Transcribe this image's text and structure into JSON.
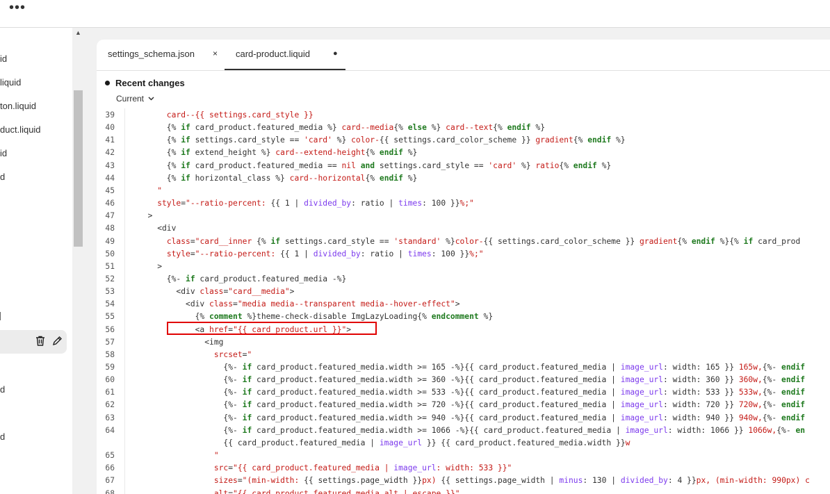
{
  "topbar": {
    "menu_icon": "more-horizontal-icon"
  },
  "sidebar": {
    "items": [
      {
        "label": "id"
      },
      {
        "label": "liquid"
      },
      {
        "label": "ton.liquid"
      },
      {
        "label": "duct.liquid"
      },
      {
        "label": "id"
      },
      {
        "label": "d"
      },
      {
        "label": ""
      },
      {
        "label": "d"
      },
      {
        "label": "d"
      }
    ],
    "active_tools": [
      "trash-icon",
      "pencil-icon"
    ]
  },
  "tabs": [
    {
      "label": "settings_schema.json",
      "close": "×"
    },
    {
      "label": "card-product.liquid",
      "modified": "●"
    }
  ],
  "recent_changes": {
    "title": "Recent changes",
    "version": "Current"
  },
  "code": {
    "line_numbers": [
      "39",
      "40",
      "41",
      "42",
      "43",
      "44",
      "45",
      "46",
      "47",
      "48",
      "49",
      "50",
      "51",
      "52",
      "53",
      "54",
      "55",
      "56",
      "57",
      "58",
      "59",
      "60",
      "61",
      "62",
      "63",
      "64",
      "",
      "65",
      "66",
      "67",
      "68"
    ],
    "lines": [
      [
        [
          "str",
          "      card--{{ settings.card_style }}"
        ]
      ],
      [
        [
          "plain",
          "      {% "
        ],
        [
          "kw",
          "if"
        ],
        [
          "plain",
          " card_product.featured_media %} "
        ],
        [
          "str",
          "card--media"
        ],
        [
          "plain",
          "{% "
        ],
        [
          "kw",
          "else"
        ],
        [
          "plain",
          " %} "
        ],
        [
          "str",
          "card--text"
        ],
        [
          "plain",
          "{% "
        ],
        [
          "kw",
          "endif"
        ],
        [
          "plain",
          " %}"
        ]
      ],
      [
        [
          "plain",
          "      {% "
        ],
        [
          "kw",
          "if"
        ],
        [
          "plain",
          " settings.card_style == "
        ],
        [
          "str",
          "'card'"
        ],
        [
          "plain",
          " %} "
        ],
        [
          "str",
          "color-"
        ],
        [
          "plain",
          "{{ settings.card_color_scheme }} "
        ],
        [
          "str",
          "gradient"
        ],
        [
          "plain",
          "{% "
        ],
        [
          "kw",
          "endif"
        ],
        [
          "plain",
          " %}"
        ]
      ],
      [
        [
          "plain",
          "      {% "
        ],
        [
          "kw",
          "if"
        ],
        [
          "plain",
          " extend_height %} "
        ],
        [
          "str",
          "card--extend-height"
        ],
        [
          "plain",
          "{% "
        ],
        [
          "kw",
          "endif"
        ],
        [
          "plain",
          " %}"
        ]
      ],
      [
        [
          "plain",
          "      {% "
        ],
        [
          "kw",
          "if"
        ],
        [
          "plain",
          " card_product.featured_media == "
        ],
        [
          "str",
          "nil"
        ],
        [
          "plain",
          " "
        ],
        [
          "kw",
          "and"
        ],
        [
          "plain",
          " settings.card_style == "
        ],
        [
          "str",
          "'card'"
        ],
        [
          "plain",
          " %} "
        ],
        [
          "str",
          "ratio"
        ],
        [
          "plain",
          "{% "
        ],
        [
          "kw",
          "endif"
        ],
        [
          "plain",
          " %}"
        ]
      ],
      [
        [
          "plain",
          "      {% "
        ],
        [
          "kw",
          "if"
        ],
        [
          "plain",
          " horizontal_class %} "
        ],
        [
          "str",
          "card--horizontal"
        ],
        [
          "plain",
          "{% "
        ],
        [
          "kw",
          "endif"
        ],
        [
          "plain",
          " %}"
        ]
      ],
      [
        [
          "str",
          "    \""
        ]
      ],
      [
        [
          "str",
          "    style"
        ],
        [
          "plain",
          "="
        ],
        [
          "str",
          "\"--ratio-percent: "
        ],
        [
          "plain",
          "{{ 1 | "
        ],
        [
          "prop",
          "divided_by"
        ],
        [
          "plain",
          ": ratio | "
        ],
        [
          "prop",
          "times"
        ],
        [
          "plain",
          ": 100 }}"
        ],
        [
          "str",
          "%;\""
        ]
      ],
      [
        [
          "plain",
          "  >"
        ]
      ],
      [
        [
          "plain",
          "    <div"
        ]
      ],
      [
        [
          "plain",
          "      "
        ],
        [
          "str",
          "class"
        ],
        [
          "plain",
          "="
        ],
        [
          "str",
          "\"card__inner "
        ],
        [
          "plain",
          "{% "
        ],
        [
          "kw",
          "if"
        ],
        [
          "plain",
          " settings.card_style == "
        ],
        [
          "str",
          "'standard'"
        ],
        [
          "plain",
          " %}"
        ],
        [
          "str",
          "color-"
        ],
        [
          "plain",
          "{{ settings.card_color_scheme }} "
        ],
        [
          "str",
          "gradient"
        ],
        [
          "plain",
          "{% "
        ],
        [
          "kw",
          "endif"
        ],
        [
          "plain",
          " %}{% "
        ],
        [
          "kw",
          "if"
        ],
        [
          "plain",
          " card_prod"
        ]
      ],
      [
        [
          "plain",
          "      "
        ],
        [
          "str",
          "style"
        ],
        [
          "plain",
          "="
        ],
        [
          "str",
          "\"--ratio-percent: "
        ],
        [
          "plain",
          "{{ 1 | "
        ],
        [
          "prop",
          "divided_by"
        ],
        [
          "plain",
          ": ratio | "
        ],
        [
          "prop",
          "times"
        ],
        [
          "plain",
          ": 100 }}"
        ],
        [
          "str",
          "%;\""
        ]
      ],
      [
        [
          "plain",
          "    >"
        ]
      ],
      [
        [
          "plain",
          "      {%- "
        ],
        [
          "kw",
          "if"
        ],
        [
          "plain",
          " card_product.featured_media -%}"
        ]
      ],
      [
        [
          "plain",
          "        <div "
        ],
        [
          "str",
          "class"
        ],
        [
          "plain",
          "="
        ],
        [
          "str",
          "\"card__media\""
        ],
        [
          "plain",
          ">"
        ]
      ],
      [
        [
          "plain",
          "          <div "
        ],
        [
          "str",
          "class"
        ],
        [
          "plain",
          "="
        ],
        [
          "str",
          "\"media media--transparent media--hover-effect\""
        ],
        [
          "plain",
          ">"
        ]
      ],
      [
        [
          "plain",
          "            {% "
        ],
        [
          "kw",
          "comment"
        ],
        [
          "plain",
          " %}theme-check-disable ImgLazyLoading{% "
        ],
        [
          "kw",
          "endcomment"
        ],
        [
          "plain",
          " %}"
        ]
      ],
      [
        [
          "plain",
          "            <a "
        ],
        [
          "str",
          "href"
        ],
        [
          "plain",
          "="
        ],
        [
          "str",
          "\"{{ card_product.url }}\""
        ],
        [
          "plain",
          ">"
        ]
      ],
      [
        [
          "plain",
          "              <img"
        ]
      ],
      [
        [
          "plain",
          "                "
        ],
        [
          "str",
          "srcset"
        ],
        [
          "plain",
          "="
        ],
        [
          "str",
          "\""
        ]
      ],
      [
        [
          "plain",
          "                  {%- "
        ],
        [
          "kw",
          "if"
        ],
        [
          "plain",
          " card_product.featured_media.width >= 165 -%}{{ card_product.featured_media | "
        ],
        [
          "prop",
          "image_url"
        ],
        [
          "plain",
          ": width: 165 }} "
        ],
        [
          "str",
          "165w,"
        ],
        [
          "plain",
          "{%- "
        ],
        [
          "kw",
          "endif"
        ]
      ],
      [
        [
          "plain",
          "                  {%- "
        ],
        [
          "kw",
          "if"
        ],
        [
          "plain",
          " card_product.featured_media.width >= 360 -%}{{ card_product.featured_media | "
        ],
        [
          "prop",
          "image_url"
        ],
        [
          "plain",
          ": width: 360 }} "
        ],
        [
          "str",
          "360w,"
        ],
        [
          "plain",
          "{%- "
        ],
        [
          "kw",
          "endif"
        ]
      ],
      [
        [
          "plain",
          "                  {%- "
        ],
        [
          "kw",
          "if"
        ],
        [
          "plain",
          " card_product.featured_media.width >= 533 -%}{{ card_product.featured_media | "
        ],
        [
          "prop",
          "image_url"
        ],
        [
          "plain",
          ": width: 533 }} "
        ],
        [
          "str",
          "533w,"
        ],
        [
          "plain",
          "{%- "
        ],
        [
          "kw",
          "endif"
        ]
      ],
      [
        [
          "plain",
          "                  {%- "
        ],
        [
          "kw",
          "if"
        ],
        [
          "plain",
          " card_product.featured_media.width >= 720 -%}{{ card_product.featured_media | "
        ],
        [
          "prop",
          "image_url"
        ],
        [
          "plain",
          ": width: 720 }} "
        ],
        [
          "str",
          "720w,"
        ],
        [
          "plain",
          "{%- "
        ],
        [
          "kw",
          "endif"
        ]
      ],
      [
        [
          "plain",
          "                  {%- "
        ],
        [
          "kw",
          "if"
        ],
        [
          "plain",
          " card_product.featured_media.width >= 940 -%}{{ card_product.featured_media | "
        ],
        [
          "prop",
          "image_url"
        ],
        [
          "plain",
          ": width: 940 }} "
        ],
        [
          "str",
          "940w,"
        ],
        [
          "plain",
          "{%- "
        ],
        [
          "kw",
          "endif"
        ]
      ],
      [
        [
          "plain",
          "                  {%- "
        ],
        [
          "kw",
          "if"
        ],
        [
          "plain",
          " card_product.featured_media.width >= 1066 -%}{{ card_product.featured_media | "
        ],
        [
          "prop",
          "image_url"
        ],
        [
          "plain",
          ": width: 1066 }} "
        ],
        [
          "str",
          "1066w,"
        ],
        [
          "plain",
          "{%- "
        ],
        [
          "kw",
          "en"
        ]
      ],
      [
        [
          "plain",
          "                  {{ card_product.featured_media | "
        ],
        [
          "prop",
          "image_url"
        ],
        [
          "plain",
          " }} {{ card_product.featured_media.width }}"
        ],
        [
          "str",
          "w"
        ]
      ],
      [
        [
          "str",
          "                \""
        ]
      ],
      [
        [
          "plain",
          "                "
        ],
        [
          "str",
          "src"
        ],
        [
          "plain",
          "="
        ],
        [
          "str",
          "\"{{ card_product.featured_media | "
        ],
        [
          "prop",
          "image_url"
        ],
        [
          "str",
          ": width: 533 }}\""
        ]
      ],
      [
        [
          "plain",
          "                "
        ],
        [
          "str",
          "sizes"
        ],
        [
          "plain",
          "="
        ],
        [
          "str",
          "\"(min-width: "
        ],
        [
          "plain",
          "{{ settings.page_width }}"
        ],
        [
          "str",
          "px) "
        ],
        [
          "plain",
          "{{ settings.page_width | "
        ],
        [
          "prop",
          "minus"
        ],
        [
          "plain",
          ": 130 | "
        ],
        [
          "prop",
          "divided_by"
        ],
        [
          "plain",
          ": 4 }}"
        ],
        [
          "str",
          "px, (min-width: 990px) c"
        ]
      ],
      [
        [
          "plain",
          "                "
        ],
        [
          "str",
          "alt"
        ],
        [
          "plain",
          "="
        ],
        [
          "str",
          "\"{{ card_product.featured_media.alt | escape }}\""
        ]
      ]
    ]
  }
}
